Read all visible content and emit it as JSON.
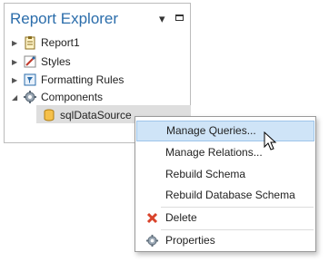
{
  "panel": {
    "title": "Report Explorer",
    "controls": {
      "pin": "pin-icon",
      "maximize": "maximize-icon"
    }
  },
  "tree": {
    "items": [
      {
        "label": "Report1",
        "icon": "report-icon",
        "expanded": false
      },
      {
        "label": "Styles",
        "icon": "styles-icon",
        "expanded": false
      },
      {
        "label": "Formatting Rules",
        "icon": "formatting-rules-icon",
        "expanded": false
      },
      {
        "label": "Components",
        "icon": "gear-icon",
        "expanded": true
      },
      {
        "label": "sqlDataSource",
        "icon": "database-icon",
        "selected": true
      }
    ]
  },
  "context_menu": {
    "items": [
      {
        "label": "Manage Queries...",
        "highlighted": true
      },
      {
        "label": "Manage Relations..."
      },
      {
        "label": "Rebuild Schema"
      },
      {
        "label": "Rebuild Database Schema"
      },
      {
        "label": "Delete",
        "icon": "delete-icon"
      },
      {
        "label": "Properties",
        "icon": "properties-icon"
      }
    ]
  },
  "colors": {
    "title": "#2b6dab",
    "highlight": "#cfe4f7",
    "highlight_border": "#9ec5ea",
    "selected": "#dedede",
    "delete": "#d9432b"
  }
}
